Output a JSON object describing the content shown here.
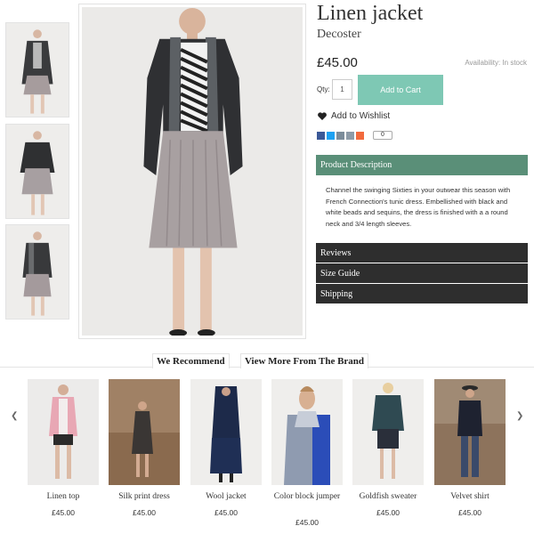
{
  "product": {
    "title": "Linen jacket",
    "brand": "Decoster",
    "price": "£45.00",
    "availability": "Availability: In stock",
    "qty_label": "Qty:",
    "qty_value": "1",
    "add_to_cart": "Add to Cart",
    "wishlist": "Add to Wishlist",
    "share_count": "0"
  },
  "accordion": {
    "description_title": "Product Description",
    "description_text": "Channel the swinging Sixties in your outwear this season with French Connection's tunic dress. Embellished with black and white beads and sequins, the dress is finished with a a round neck and 3/4 length sleeves.",
    "reviews": "Reviews",
    "size_guide": "Size Guide",
    "shipping": "Shipping"
  },
  "tabs": {
    "recommend": "We Recommend",
    "brand": "View More From The Brand"
  },
  "carousel": {
    "prev_icon": "chevron-left-icon",
    "next_icon": "chevron-right-icon",
    "items": [
      {
        "name": "Linen top",
        "price": "£45.00"
      },
      {
        "name": "Silk print dress",
        "price": "£45.00"
      },
      {
        "name": "Wool jacket",
        "price": "£45.00"
      },
      {
        "name": "Color block jumper",
        "price": "£45.00"
      },
      {
        "name": "Goldfish sweater",
        "price": "£45.00"
      },
      {
        "name": "Velvet shirt",
        "price": "£45.00"
      }
    ]
  },
  "colors": {
    "accent_button": "#7ec8b4",
    "accordion_active": "#5a8f78",
    "accordion_dark": "#2e2e2e"
  }
}
